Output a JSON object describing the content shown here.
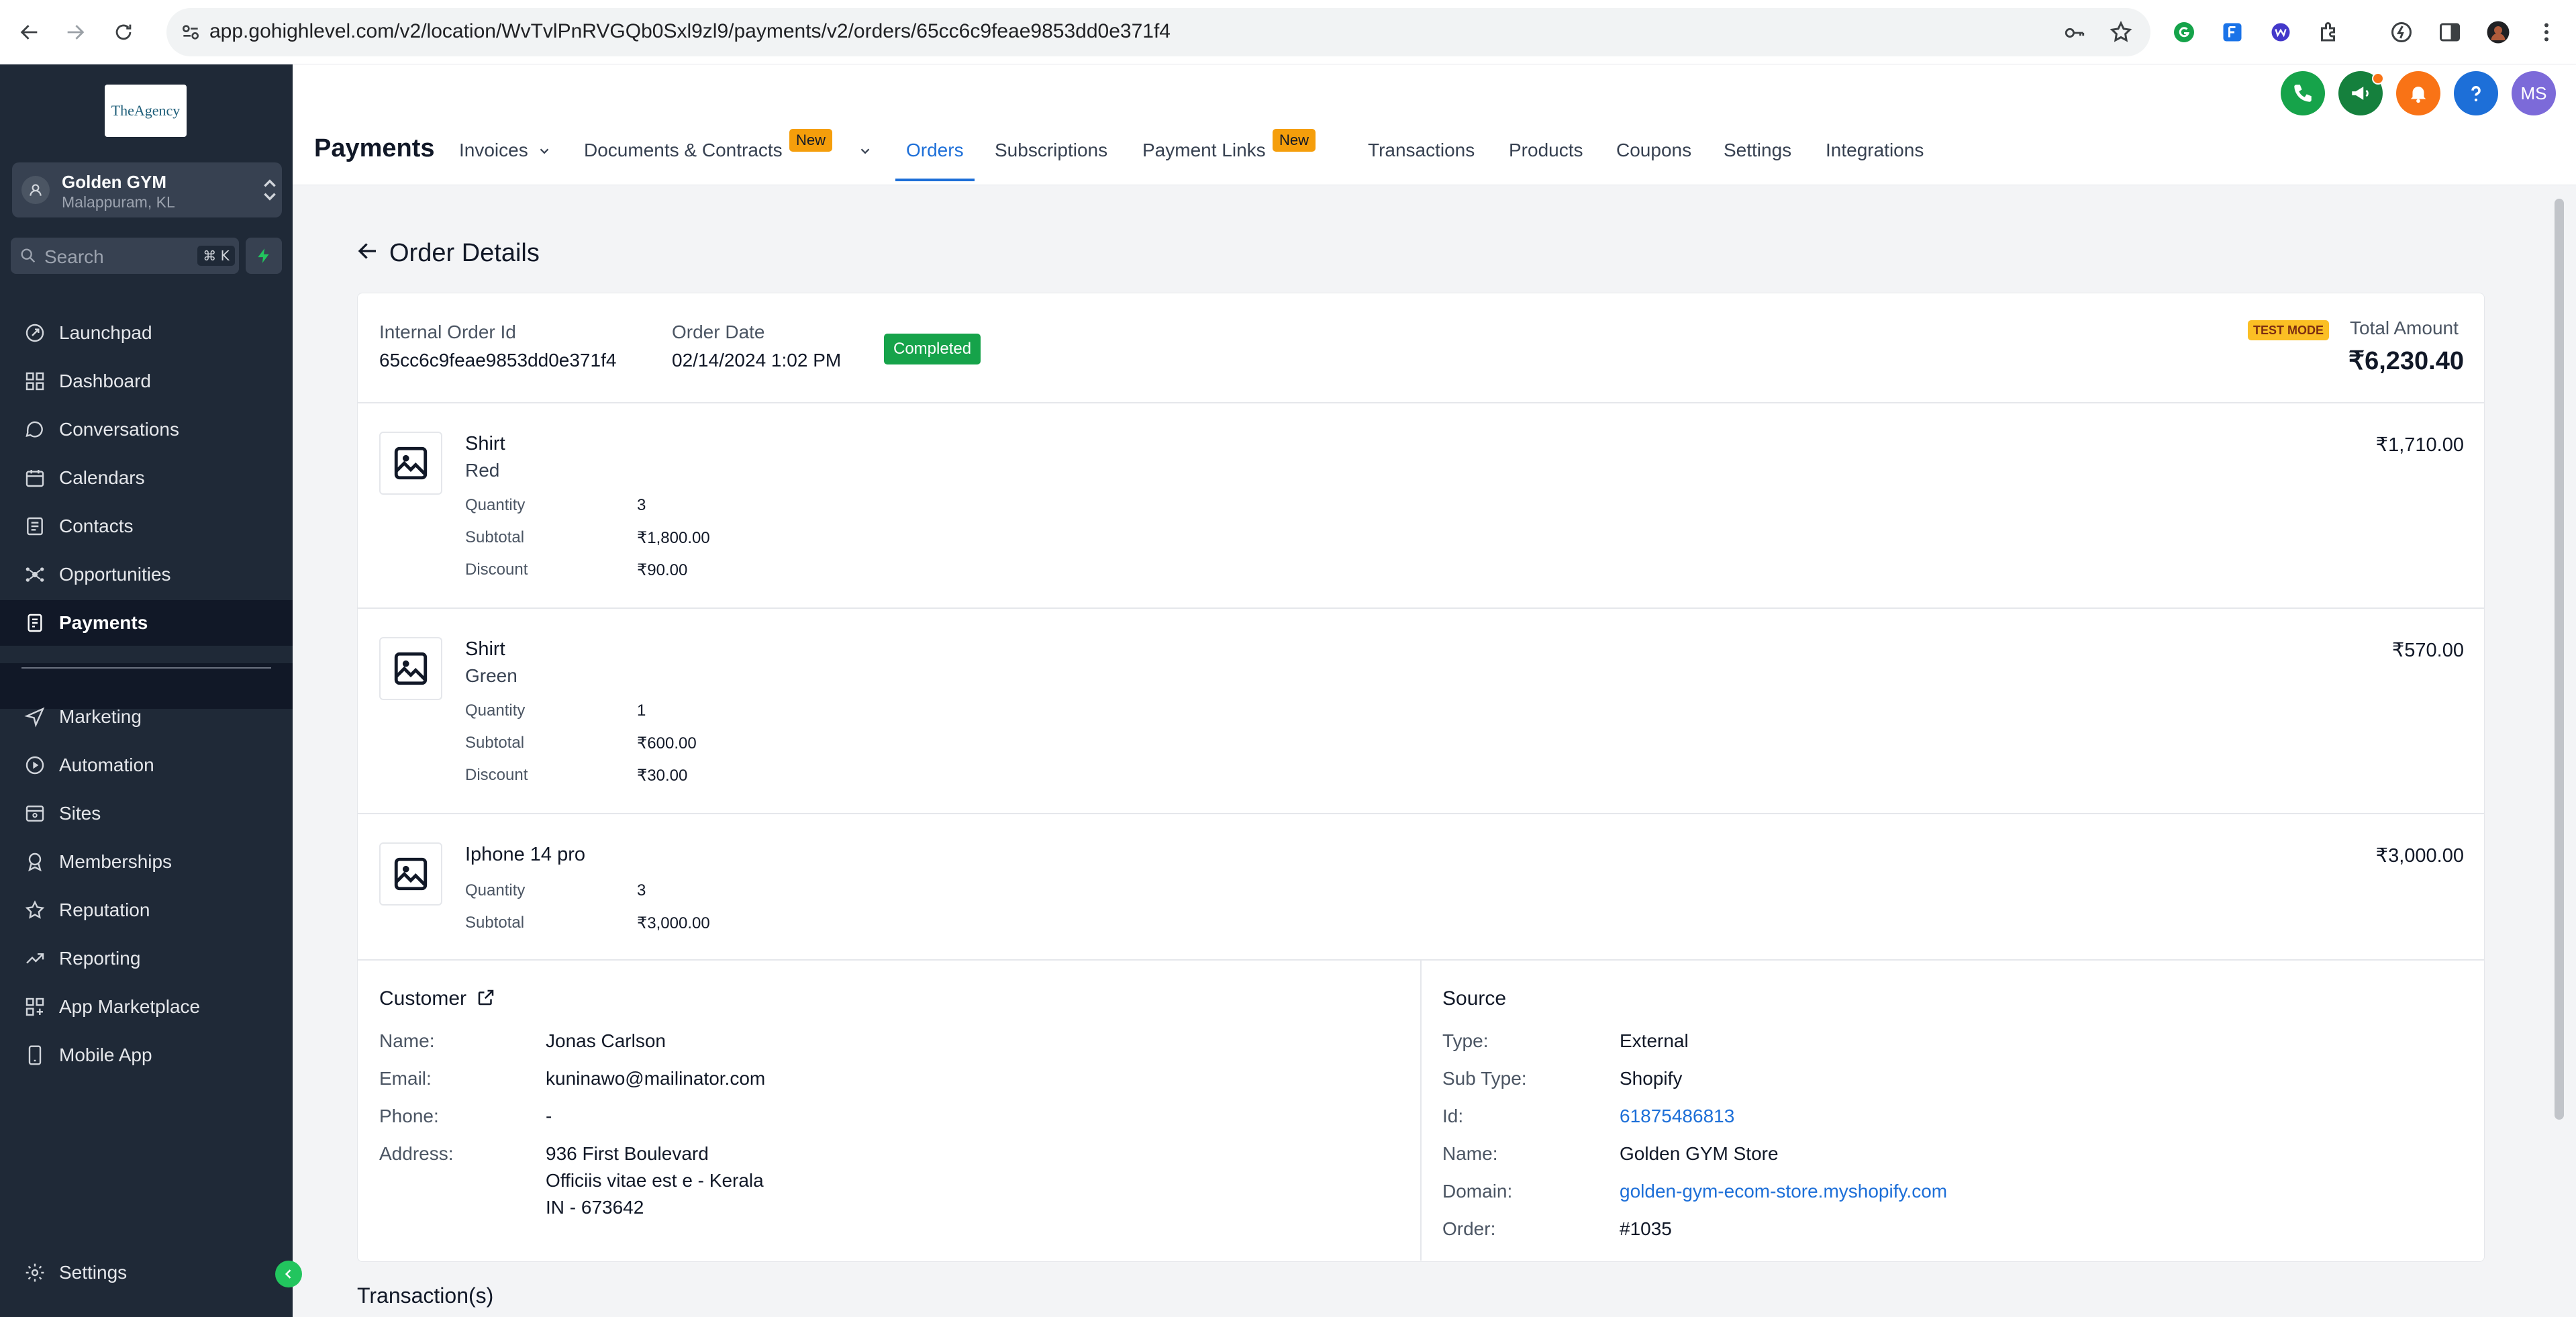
{
  "browser": {
    "url": "app.gohighlevel.com/v2/location/WvTvlPnRVGQb0Sxl9zl9/payments/v2/orders/65cc6c9feae9853dd0e371f4"
  },
  "sidebar": {
    "logo_text": "TheAgency",
    "location": {
      "name": "Golden GYM",
      "sub": "Malappuram, KL"
    },
    "search": {
      "label": "Search",
      "shortcut": "⌘ K"
    },
    "items": [
      {
        "label": "Launchpad",
        "icon": "rocket-icon"
      },
      {
        "label": "Dashboard",
        "icon": "grid-icon"
      },
      {
        "label": "Conversations",
        "icon": "chat-icon"
      },
      {
        "label": "Calendars",
        "icon": "calendar-icon"
      },
      {
        "label": "Contacts",
        "icon": "contacts-icon"
      },
      {
        "label": "Opportunities",
        "icon": "network-icon"
      },
      {
        "label": "Payments",
        "icon": "payments-icon",
        "active": true
      },
      {
        "label": "Marketing",
        "icon": "send-icon"
      },
      {
        "label": "Automation",
        "icon": "automation-icon"
      },
      {
        "label": "Sites",
        "icon": "sites-icon"
      },
      {
        "label": "Memberships",
        "icon": "badge-icon"
      },
      {
        "label": "Reputation",
        "icon": "star-icon"
      },
      {
        "label": "Reporting",
        "icon": "chart-icon"
      },
      {
        "label": "App Marketplace",
        "icon": "apps-icon"
      },
      {
        "label": "Mobile App",
        "icon": "mobile-icon"
      }
    ],
    "settings_label": "Settings"
  },
  "header": {
    "title": "Payments",
    "tabs": [
      {
        "label": "Invoices"
      },
      {
        "label": "Documents & Contracts",
        "badge": "New"
      },
      {
        "label": "Orders",
        "active": true
      },
      {
        "label": "Subscriptions"
      },
      {
        "label": "Payment Links",
        "badge": "New"
      },
      {
        "label": "Transactions"
      },
      {
        "label": "Products"
      },
      {
        "label": "Coupons"
      },
      {
        "label": "Settings"
      },
      {
        "label": "Integrations"
      }
    ],
    "avatar_initials": "MS"
  },
  "order": {
    "page_title": "Order Details",
    "internal_id_label": "Internal Order Id",
    "internal_id": "65cc6c9feae9853dd0e371f4",
    "date_label": "Order Date",
    "date": "02/14/2024 1:02 PM",
    "status": "Completed",
    "test_mode": "TEST MODE",
    "total_label": "Total Amount",
    "total": "₹6,230.40",
    "items": [
      {
        "name": "Shirt",
        "variant": "Red",
        "price": "₹1,710.00",
        "quantity_label": "Quantity",
        "quantity": "3",
        "subtotal_label": "Subtotal",
        "subtotal": "₹1,800.00",
        "discount_label": "Discount",
        "discount": "₹90.00"
      },
      {
        "name": "Shirt",
        "variant": "Green",
        "price": "₹570.00",
        "quantity_label": "Quantity",
        "quantity": "1",
        "subtotal_label": "Subtotal",
        "subtotal": "₹600.00",
        "discount_label": "Discount",
        "discount": "₹30.00"
      },
      {
        "name": "Iphone 14 pro",
        "price": "₹3,000.00",
        "quantity_label": "Quantity",
        "quantity": "3",
        "subtotal_label": "Subtotal",
        "subtotal": "₹3,000.00"
      }
    ],
    "customer": {
      "title": "Customer",
      "name_label": "Name:",
      "name": "Jonas Carlson",
      "email_label": "Email:",
      "email": "kuninawo@mailinator.com",
      "phone_label": "Phone:",
      "phone": "-",
      "address_label": "Address:",
      "address_line1": "936 First Boulevard",
      "address_line2": "Officiis vitae est e - Kerala",
      "address_line3": "IN - 673642"
    },
    "source": {
      "title": "Source",
      "type_label": "Type:",
      "type": "External",
      "subtype_label": "Sub Type:",
      "subtype": "Shopify",
      "id_label": "Id:",
      "id": "61875486813",
      "name_label": "Name:",
      "name": "Golden GYM Store",
      "domain_label": "Domain:",
      "domain": "golden-gym-ecom-store.myshopify.com",
      "order_label": "Order:",
      "order": "#1035"
    },
    "transactions_title": "Transaction(s)"
  },
  "colors": {
    "accent": "#1d6fd8",
    "sidebar_bg": "#1f2937",
    "status_green": "#16a34a",
    "badge_new": "#f59e0b"
  }
}
